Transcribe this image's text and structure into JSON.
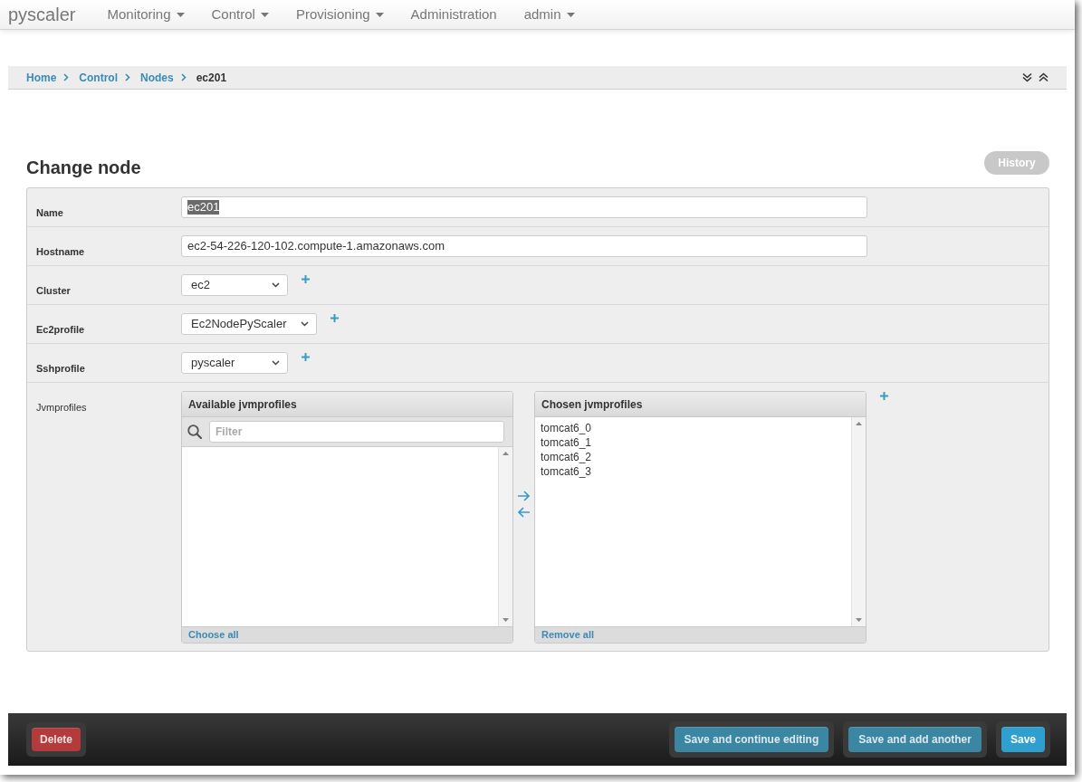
{
  "navbar": {
    "brand": "pyscaler",
    "menu": [
      {
        "label": "Monitoring",
        "dropdown": true
      },
      {
        "label": "Control",
        "dropdown": true
      },
      {
        "label": "Provisioning",
        "dropdown": true
      },
      {
        "label": "Administration",
        "dropdown": false
      },
      {
        "label": "admin",
        "dropdown": true
      }
    ]
  },
  "breadcrumb": [
    {
      "label": "Home",
      "kind": "link"
    },
    {
      "label": "Control",
      "kind": "link"
    },
    {
      "label": "Nodes",
      "kind": "link"
    },
    {
      "label": "ec201",
      "kind": "current"
    }
  ],
  "header": {
    "title": "Change node",
    "history_button": "History"
  },
  "form": {
    "rows": [
      {
        "kind": "text",
        "label": "Name",
        "required": true,
        "value": "ec201",
        "highlighted": true,
        "addable": false
      },
      {
        "kind": "text",
        "label": "Hostname",
        "required": true,
        "value": "ec2-54-226-120-102.compute-1.amazonaws.com",
        "highlighted": false,
        "addable": false
      },
      {
        "kind": "select",
        "label": "Cluster",
        "required": true,
        "value": "ec2",
        "addable": true
      },
      {
        "kind": "select",
        "label": "Ec2profile",
        "required": true,
        "value": "Ec2NodePyScaler",
        "addable": true
      },
      {
        "kind": "select",
        "label": "Sshprofile",
        "required": true,
        "value": "pyscaler",
        "addable": true
      },
      {
        "kind": "multiselect",
        "label": "Jvmprofiles",
        "required": false,
        "addable": true,
        "available": {
          "title": "Available jvmprofiles",
          "filter_placeholder": "Filter",
          "footer_link": "Choose all"
        },
        "chosen": {
          "title": "Chosen jvmprofiles",
          "items": [
            "tomcat6_0",
            "tomcat6_1",
            "tomcat6_2",
            "tomcat6_3"
          ],
          "footer_link": "Remove all"
        }
      }
    ]
  },
  "actions": {
    "left": [
      {
        "label": "Delete",
        "kind": "danger"
      }
    ],
    "right": [
      {
        "label": "Save and continue editing",
        "kind": "secondary"
      },
      {
        "label": "Save and add another",
        "kind": "secondary"
      },
      {
        "label": "Save",
        "kind": "primary"
      }
    ]
  }
}
